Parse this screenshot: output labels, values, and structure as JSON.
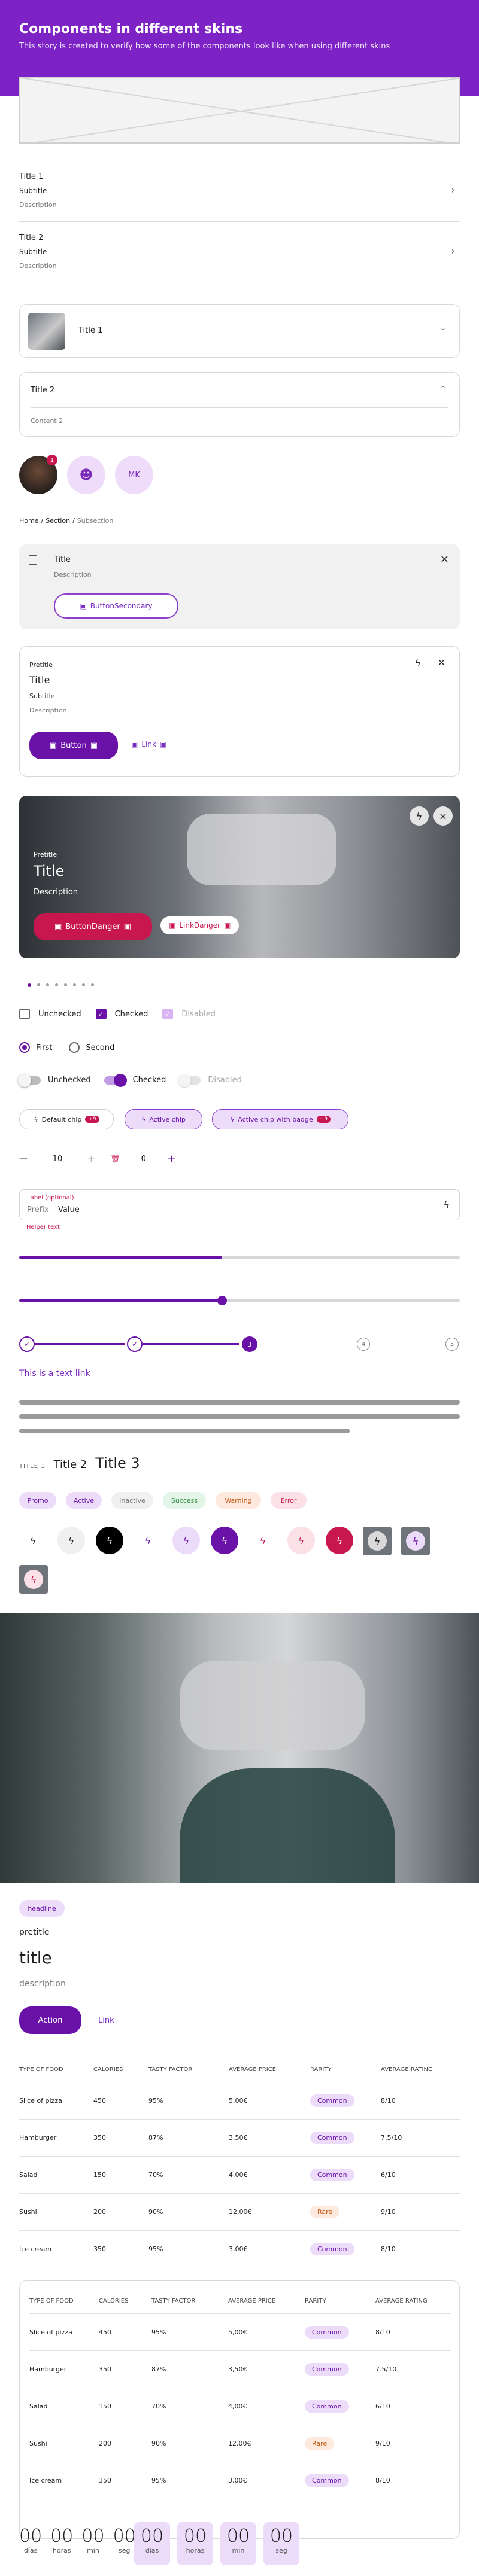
{
  "header": {
    "title": "Components in different skins",
    "subtitle": "This story is created to verify how some of the components look like when using different skins"
  },
  "rows": [
    {
      "title": "Title 1",
      "subtitle": "Subtitle",
      "description": "Description"
    },
    {
      "title": "Title 2",
      "subtitle": "Subtitle",
      "description": "Description"
    }
  ],
  "accordion1": {
    "title": "Title 1"
  },
  "accordion2": {
    "title": "Title 2",
    "content": "Content 2"
  },
  "avatars": {
    "badge": "1",
    "initials": "MK"
  },
  "breadcrumb": {
    "home": "Home",
    "sep1": "/",
    "section": "Section",
    "sep2": "/",
    "subsection": "Subsection"
  },
  "callout": {
    "title": "Title",
    "description": "Description",
    "button": "ButtonSecondary"
  },
  "card1": {
    "pretitle": "Pretitle",
    "title": "Title",
    "subtitle": "Subtitle",
    "description": "Description",
    "button": "Button",
    "link": "Link"
  },
  "card2": {
    "pretitle": "Pretitle",
    "title": "Title",
    "description": "Description",
    "button": "ButtonDanger",
    "link": "LinkDanger"
  },
  "checkboxes": {
    "unchecked": "Unchecked",
    "checked": "Checked",
    "disabled": "Disabled"
  },
  "radios": {
    "first": "First",
    "second": "Second"
  },
  "switches": {
    "unchecked": "Unchecked",
    "checked": "Checked",
    "disabled": "Disabled"
  },
  "chips": {
    "default": "Default chip",
    "default_badge": "+9",
    "active": "Active chip",
    "active_badge_label": "Active chip with badge",
    "active_badge": "+9"
  },
  "steppers": {
    "first": "10",
    "second": "0"
  },
  "textfield": {
    "label": "Label (optional)",
    "prefix": "Prefix",
    "value": "Value",
    "helper": "Helper text"
  },
  "progress": {
    "bar1_fraction": 0.46,
    "slider_fraction": 0.46,
    "step_current": "3",
    "step_4": "4",
    "step_5": "5"
  },
  "textlink": "This is a text link",
  "titles": {
    "t1": "TITLE 1",
    "t2": "Title 2",
    "t3": "Title 3"
  },
  "tags": [
    "Promo",
    "Active",
    "Inactive",
    "Success",
    "Warning",
    "Error"
  ],
  "hero": {
    "tag": "headline",
    "pretitle": "pretitle",
    "title": "title",
    "description": "description",
    "action": "Action",
    "link": "Link"
  },
  "table_headers": [
    "TYPE OF FOOD",
    "CALORIES",
    "TASTY FACTOR",
    "AVERAGE PRICE",
    "RARITY",
    "AVERAGE RATING"
  ],
  "table_rows": [
    [
      "Slice of pizza",
      "450",
      "95%",
      "5,00€",
      "Common",
      "8/10"
    ],
    [
      "Hamburger",
      "350",
      "87%",
      "3,50€",
      "Common",
      "7.5/10"
    ],
    [
      "Salad",
      "150",
      "70%",
      "4,00€",
      "Common",
      "6/10"
    ],
    [
      "Sushi",
      "200",
      "90%",
      "12,00€",
      "Rare",
      "9/10"
    ],
    [
      "Ice cream",
      "350",
      "95%",
      "3,00€",
      "Common",
      "8/10"
    ]
  ],
  "countdown": {
    "values": [
      "00",
      "00",
      "00",
      "00"
    ],
    "labels": [
      "días",
      "horas",
      "min",
      "seg"
    ]
  },
  "colors": {
    "brand": "#7d22c4",
    "primary": "#6a12a8",
    "danger": "#c8174f",
    "chip_bg": "#ecdcfa"
  }
}
